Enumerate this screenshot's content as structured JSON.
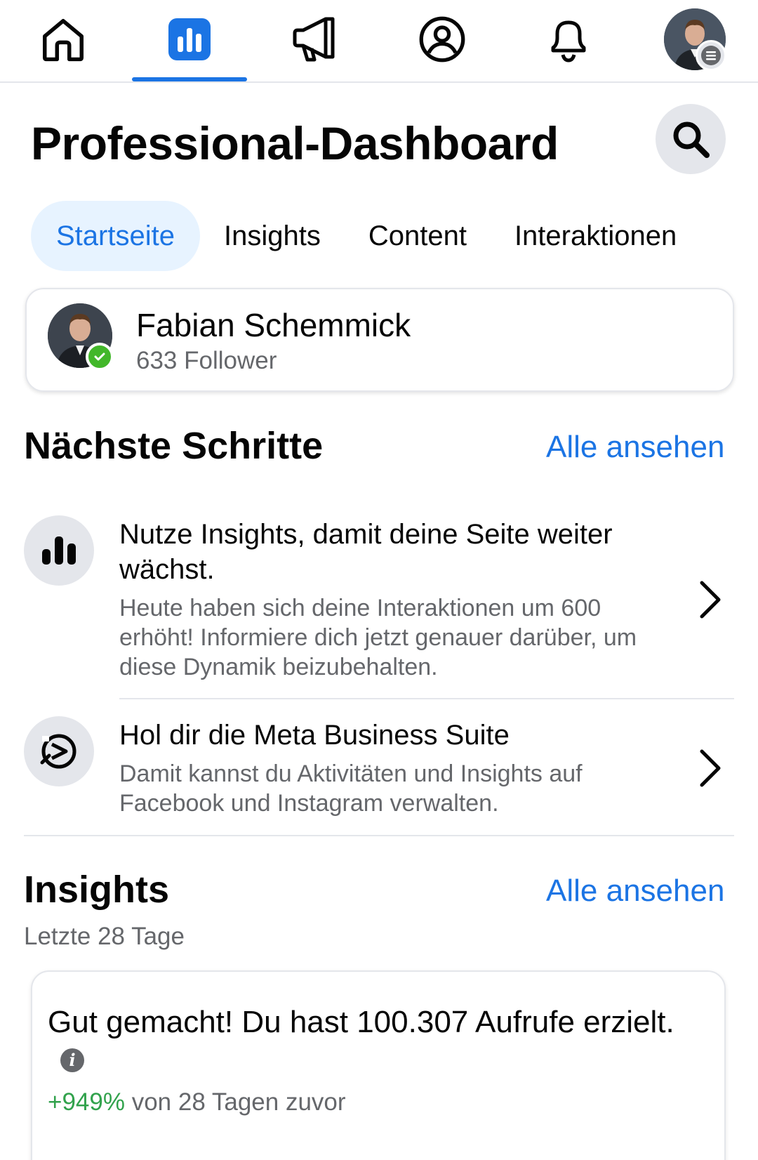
{
  "nav": {
    "items": [
      {
        "name": "home"
      },
      {
        "name": "dashboard"
      },
      {
        "name": "ads"
      },
      {
        "name": "profile"
      },
      {
        "name": "notifications"
      },
      {
        "name": "account-menu"
      }
    ],
    "active_index": 1
  },
  "header": {
    "title": "Professional-Dashboard"
  },
  "tabs": [
    {
      "label": "Startseite",
      "active": true
    },
    {
      "label": "Insights",
      "active": false
    },
    {
      "label": "Content",
      "active": false
    },
    {
      "label": "Interaktionen",
      "active": false
    }
  ],
  "profile": {
    "name": "Fabian Schemmick",
    "followers": "633 Follower"
  },
  "next_steps": {
    "title": "Nächste Schritte",
    "see_all": "Alle ansehen",
    "items": [
      {
        "icon": "bar-chart-icon",
        "title": "Nutze Insights, damit deine Seite weiter wächst.",
        "description": "Heute haben sich deine Interaktionen um 600 erhöht! Informiere dich jetzt genauer darüber, um diese Dynamik beizubehalten."
      },
      {
        "icon": "meta-business-suite-icon",
        "title": "Hol dir die Meta Business Suite",
        "description": "Damit kannst du Aktivitäten und Insights auf Facebook und Instagram verwalten."
      }
    ]
  },
  "insights": {
    "title": "Insights",
    "see_all": "Alle ansehen",
    "period": "Letzte 28 Tage",
    "headline": "Gut gemacht! Du hast 100.307 Aufrufe erzielt.",
    "delta_value": "+949%",
    "delta_text": "von 28 Tagen zuvor"
  },
  "colors": {
    "accent": "#1b74e4",
    "positive": "#31a24c",
    "secondary_text": "#65676b",
    "divider": "#e4e6eb"
  }
}
